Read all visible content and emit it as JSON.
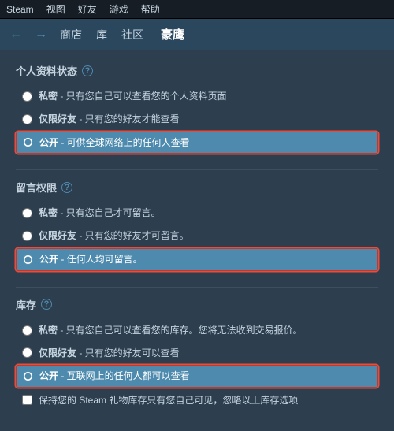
{
  "menubar": {
    "items": [
      "Steam",
      "视图",
      "好友",
      "游戏",
      "帮助"
    ]
  },
  "navbar": {
    "back_arrow": "←",
    "forward_arrow": "→",
    "links": [
      "商店",
      "库",
      "社区"
    ],
    "username": "豪鹰"
  },
  "profile_section": {
    "title": "个人资料状态",
    "help": "?",
    "options": [
      {
        "id": "profile-private",
        "label": "私密",
        "desc": "只有您自己可以查看您的个人资料页面",
        "selected": false
      },
      {
        "id": "profile-friends",
        "label": "仅限好友",
        "desc": "只有您的好友才能查看",
        "selected": false
      },
      {
        "id": "profile-public",
        "label": "公开",
        "desc": "可供全球网络上的任何人查看",
        "selected": true
      }
    ]
  },
  "comment_section": {
    "title": "留言权限",
    "help": "?",
    "options": [
      {
        "id": "comment-private",
        "label": "私密",
        "desc": "只有您自己才可留言。",
        "selected": false
      },
      {
        "id": "comment-friends",
        "label": "仅限好友",
        "desc": "只有您的好友才可留言。",
        "selected": false
      },
      {
        "id": "comment-public",
        "label": "公开",
        "desc": "任何人均可留言。",
        "selected": true
      }
    ]
  },
  "inventory_section": {
    "title": "库存",
    "help": "?",
    "options": [
      {
        "id": "inv-private",
        "label": "私密",
        "desc": "只有您自己可以查看您的库存。您将无法收到交易报价。",
        "selected": false
      },
      {
        "id": "inv-friends",
        "label": "仅限好友",
        "desc": "只有您的好友可以查看",
        "selected": false
      },
      {
        "id": "inv-public",
        "label": "公开",
        "desc": "互联网上的任何人都可以查看",
        "selected": true
      }
    ],
    "checkbox_label": "保持您的 Steam 礼物库存只有您自己可见，忽略以上库存选项"
  }
}
